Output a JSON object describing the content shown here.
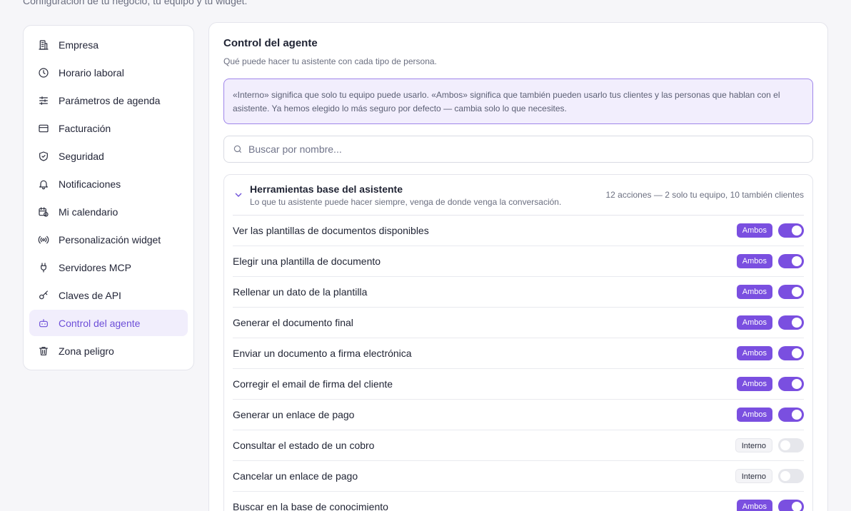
{
  "page": {
    "subtitle": "Configuración de tu negocio, tu equipo y tu widget."
  },
  "sidebar": {
    "items": [
      {
        "label": "Empresa",
        "icon": "building-icon"
      },
      {
        "label": "Horario laboral",
        "icon": "clock-icon"
      },
      {
        "label": "Parámetros de agenda",
        "icon": "sliders-icon"
      },
      {
        "label": "Facturación",
        "icon": "credit-card-icon"
      },
      {
        "label": "Seguridad",
        "icon": "shield-check-icon"
      },
      {
        "label": "Notificaciones",
        "icon": "bell-icon"
      },
      {
        "label": "Mi calendario",
        "icon": "calendar-clock-icon"
      },
      {
        "label": "Personalización widget",
        "icon": "broadcast-icon"
      },
      {
        "label": "Servidores MCP",
        "icon": "plug-icon"
      },
      {
        "label": "Claves de API",
        "icon": "key-icon"
      },
      {
        "label": "Control del agente",
        "icon": "bot-icon",
        "active": true
      },
      {
        "label": "Zona peligro",
        "icon": "trash-icon"
      }
    ]
  },
  "main": {
    "title": "Control del agente",
    "subtitle": "Qué puede hacer tu asistente con cada tipo de persona.",
    "info": "«Interno» significa que solo tu equipo puede usarlo. «Ambos» significa que también pueden usarlo tus clientes y las personas que hablan con el asistente. Ya hemos elegido lo más seguro por defecto — cambia solo lo que necesites.",
    "search": {
      "placeholder": "Buscar por nombre..."
    },
    "group": {
      "title": "Herramientas base del asistente",
      "description": "Lo que tu asistente puede hacer siempre, venga de donde venga la conversación.",
      "count": "12 acciones — 2 solo tu equipo, 10 también clientes",
      "rows": [
        {
          "label": "Ver las plantillas de documentos disponibles",
          "badge": "Ambos",
          "on": true
        },
        {
          "label": "Elegir una plantilla de documento",
          "badge": "Ambos",
          "on": true
        },
        {
          "label": "Rellenar un dato de la plantilla",
          "badge": "Ambos",
          "on": true
        },
        {
          "label": "Generar el documento final",
          "badge": "Ambos",
          "on": true
        },
        {
          "label": "Enviar un documento a firma electrónica",
          "badge": "Ambos",
          "on": true
        },
        {
          "label": "Corregir el email de firma del cliente",
          "badge": "Ambos",
          "on": true
        },
        {
          "label": "Generar un enlace de pago",
          "badge": "Ambos",
          "on": true
        },
        {
          "label": "Consultar el estado de un cobro",
          "badge": "Interno",
          "on": false
        },
        {
          "label": "Cancelar un enlace de pago",
          "badge": "Interno",
          "on": false
        },
        {
          "label": "Buscar en la base de conocimiento",
          "badge": "Ambos",
          "on": true
        }
      ]
    }
  },
  "colors": {
    "accent": "#7a4fe0",
    "active_bg": "#f1eefc",
    "info_bg": "#f2eefd"
  }
}
